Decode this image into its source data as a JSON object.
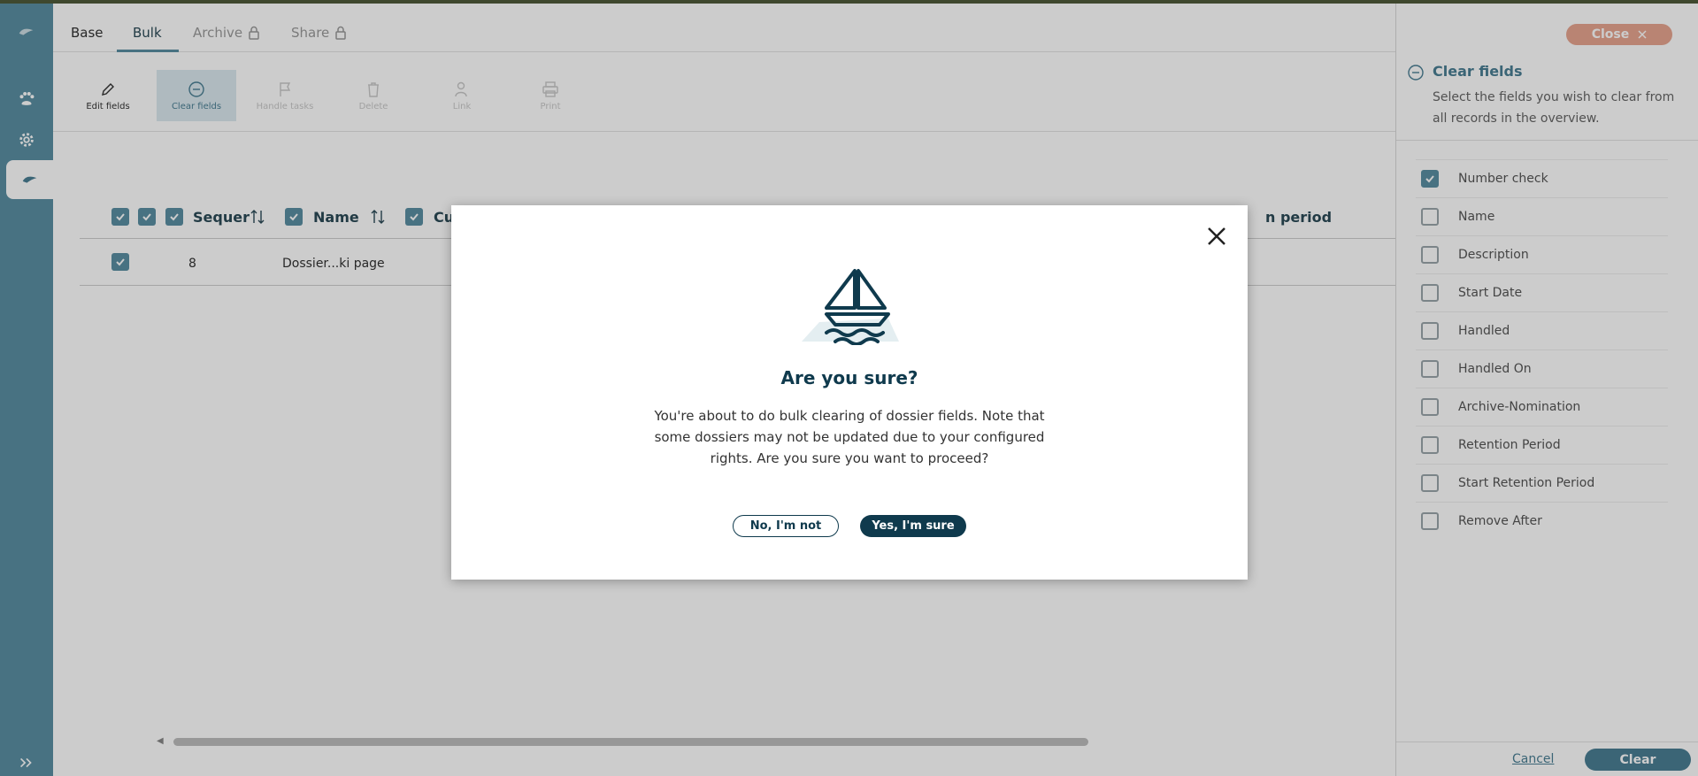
{
  "tabs": [
    {
      "label": "Base"
    },
    {
      "label": "Bulk"
    },
    {
      "label": "Archive"
    },
    {
      "label": "Share"
    }
  ],
  "toolbar": {
    "items": [
      {
        "label": "Edit fields",
        "icon": "pencil-icon"
      },
      {
        "label": "Clear fields",
        "icon": "minus-circle-icon"
      },
      {
        "label": "Handle tasks",
        "icon": "flag-icon"
      },
      {
        "label": "Delete",
        "icon": "trash-icon"
      },
      {
        "label": "Link",
        "icon": "user-link-icon"
      },
      {
        "label": "Print",
        "icon": "printer-icon"
      }
    ]
  },
  "grid": {
    "headers": [
      {
        "label": "Sequer"
      },
      {
        "label": "Name"
      },
      {
        "label": "Cu"
      },
      {
        "label": "n period"
      }
    ],
    "rows": [
      {
        "sequence": "8",
        "name": "Dossier...ki page"
      }
    ]
  },
  "panel": {
    "close_label": "Close",
    "title": "Clear fields",
    "description": "Select the fields you wish to clear from all records in the overview.",
    "fields": [
      {
        "label": "Number check",
        "checked": true
      },
      {
        "label": "Name",
        "checked": false
      },
      {
        "label": "Description",
        "checked": false
      },
      {
        "label": "Start Date",
        "checked": false
      },
      {
        "label": "Handled",
        "checked": false
      },
      {
        "label": "Handled On",
        "checked": false
      },
      {
        "label": "Archive-Nomination",
        "checked": false
      },
      {
        "label": "Retention Period",
        "checked": false
      },
      {
        "label": "Start Retention Period",
        "checked": false
      },
      {
        "label": "Remove After",
        "checked": false
      }
    ],
    "cancel_label": "Cancel",
    "clear_label": "Clear"
  },
  "modal": {
    "title": "Are you sure?",
    "message": "You're about to do bulk clearing of dossier fields. Note that some dossiers may not be updated due to your configured rights. Are you sure you want to proceed?",
    "no_label": "No, I'm not",
    "yes_label": "Yes, I'm sure"
  },
  "colors": {
    "rail": "#5b8fa3",
    "accent": "#4a7f94",
    "modal_primary": "#0f3a4d",
    "close_button": "#e8a590"
  }
}
